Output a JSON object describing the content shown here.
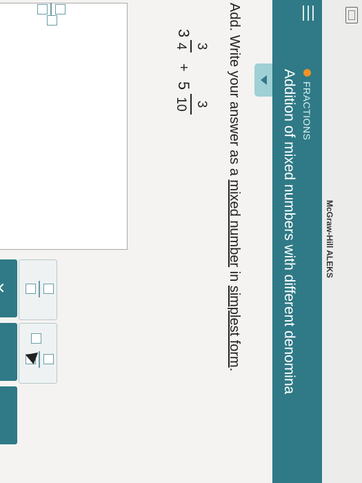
{
  "app": {
    "brand": "McGraw-Hill ALEKS"
  },
  "topic": {
    "category": "FRACTIONS",
    "title": "Addition of mixed numbers with different denomina"
  },
  "problem": {
    "instruction_prefix": "Add. Write your answer as a ",
    "link1": "mixed number",
    "instruction_mid": " in ",
    "link2": "simplest form",
    "instruction_suffix": ".",
    "term1": {
      "whole": "3",
      "num": "3",
      "den": "4"
    },
    "operator": "+",
    "term2": {
      "whole": "5",
      "num": "3",
      "den": "10"
    }
  },
  "keypad": {
    "clear_label": "✕"
  },
  "colors": {
    "accent": "#2f7a86",
    "topic_dot": "#f0912a",
    "tab": "#9fd0d6"
  },
  "icons": [
    "menu-icon",
    "collapse-arrow-icon",
    "fraction-template-icon",
    "mixed-number-template-icon",
    "close-icon",
    "cursor-icon"
  ]
}
